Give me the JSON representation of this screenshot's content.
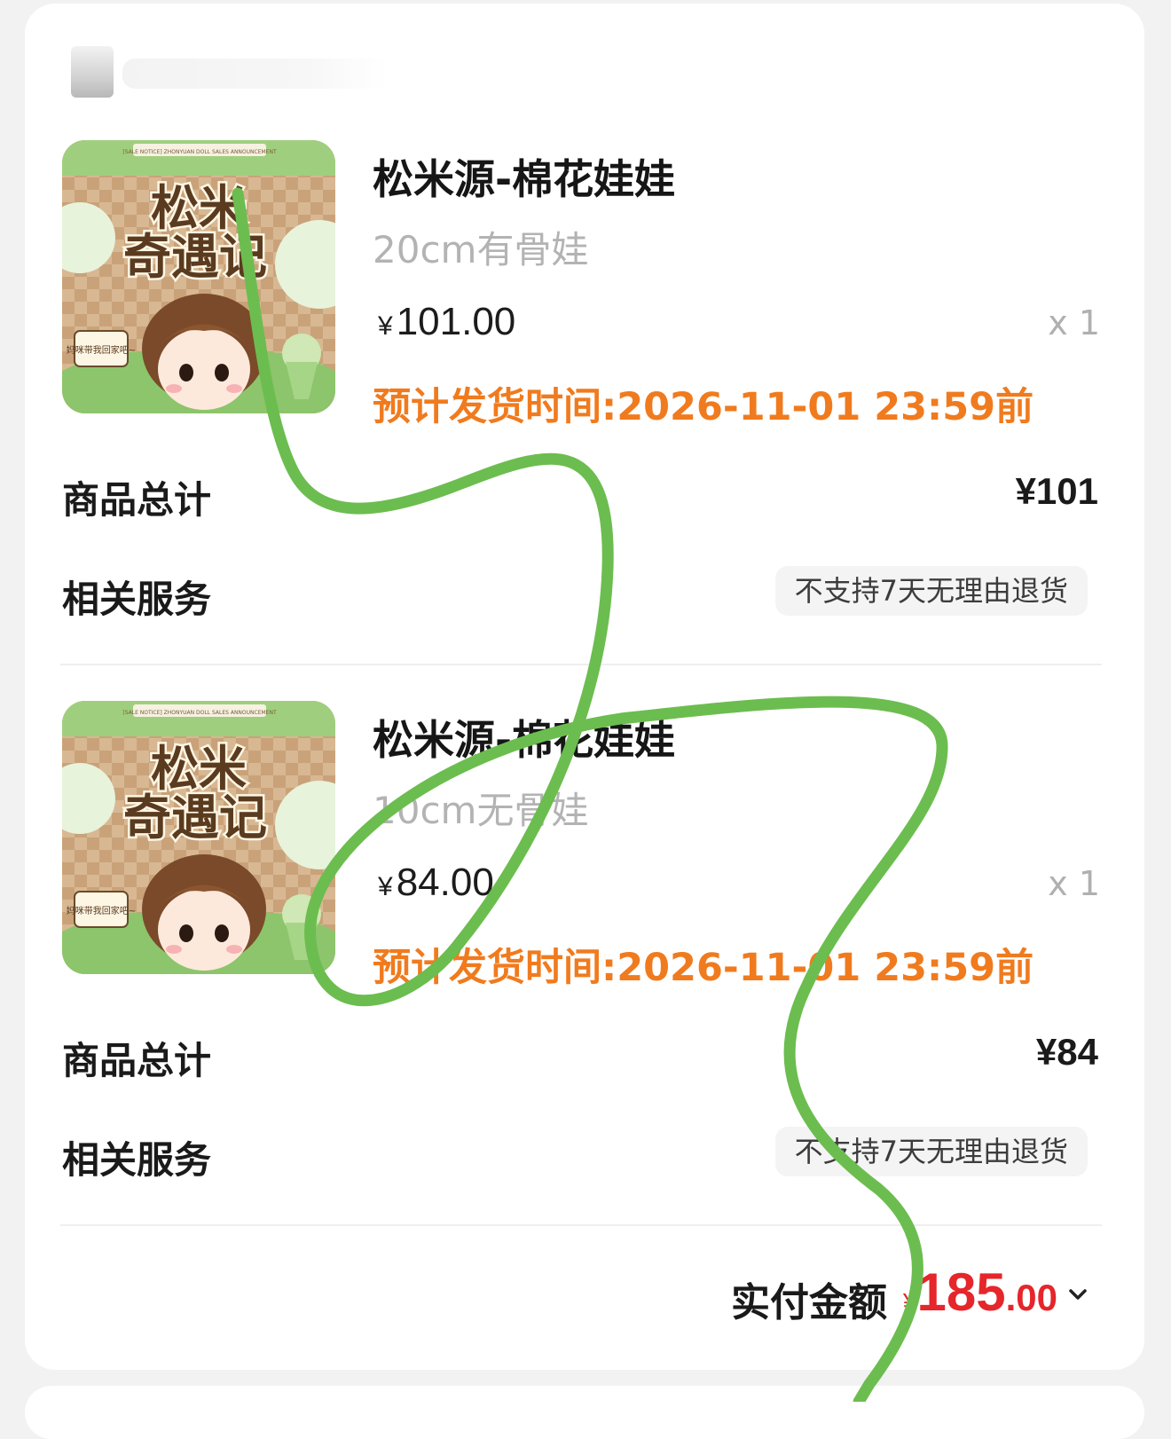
{
  "order": {
    "shop": {
      "logo_icon": "shop-logo-icon",
      "name": ""
    },
    "items": [
      {
        "title": "松米源-棉花娃娃",
        "spec": "20cm有骨娃",
        "price_symbol": "¥",
        "price": "101.00",
        "qty": "x 1",
        "ship_time": "预计发货时间:2026-11-01 23:59前",
        "subtotal_label": "商品总计",
        "subtotal": "¥101",
        "service_label": "相关服务",
        "service_tag": "不支持7天无理由退货",
        "image_text": {
          "banner": "[SALE NOTICE] ZHONYUAN DOLL SALES ANNOUNCEMENT",
          "line1": "松米",
          "line2": "奇遇记",
          "sign": "妈咪带我回家吧~"
        }
      },
      {
        "title": "松米源-棉花娃娃",
        "spec": "10cm无骨娃",
        "price_symbol": "¥",
        "price": "84.00",
        "qty": "x 1",
        "ship_time": "预计发货时间:2026-11-01 23:59前",
        "subtotal_label": "商品总计",
        "subtotal": "¥84",
        "service_label": "相关服务",
        "service_tag": "不支持7天无理由退货",
        "image_text": {
          "banner": "[SALE NOTICE] ZHONYUAN DOLL SALES ANNOUNCEMENT",
          "line1": "松米",
          "line2": "奇遇记",
          "sign": "妈咪带我回家吧~"
        }
      }
    ],
    "total": {
      "label": "实付金额",
      "symbol": "¥",
      "integer": "185",
      "decimal": ".00",
      "expand_icon": "chevron-down-icon"
    }
  },
  "colors": {
    "ship_time": "#f07b1e",
    "total_price": "#e5262b",
    "scribble": "#6cbd4f"
  }
}
